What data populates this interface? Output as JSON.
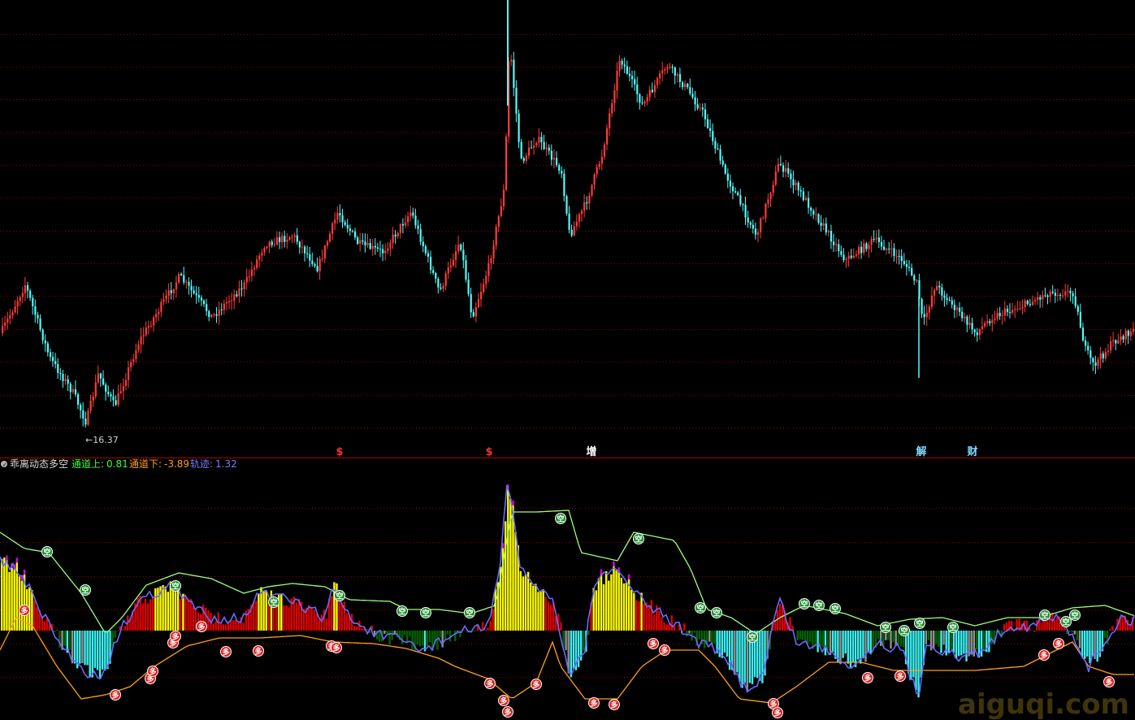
{
  "chart_data": [
    {
      "type": "candlestick",
      "low_marker_label": "16.37",
      "event_markers": [
        {
          "label": "$",
          "color": "#ff3030"
        },
        {
          "label": "$",
          "color": "#ff3030"
        },
        {
          "label": "增",
          "color": "#ffffff"
        },
        {
          "label": "解",
          "color": "#7fdcff"
        },
        {
          "label": "财",
          "color": "#7fdcff"
        }
      ],
      "colors": {
        "up": "#ff3b3b",
        "down": "#54fcfc",
        "grid": "#8b0000"
      }
    },
    {
      "type": "indicator",
      "name": "乖离动态多空",
      "legend": [
        {
          "label": "通道上:",
          "value": "0.81",
          "color": "#3cff3c"
        },
        {
          "label": "通道下:",
          "value": "-3.89",
          "color": "#ff9f1a"
        },
        {
          "label": "轨迹:",
          "value": "1.32",
          "color": "#6a6aff"
        }
      ],
      "signal_up_label": "空",
      "signal_down_label": "多",
      "colors": {
        "bar_pos": "#e00000",
        "bar_pos_high": "#ffff00",
        "bar_peak": "#e000e0",
        "bar_neg": "#006400",
        "bar_neg_low": "#3cf0f0",
        "bar_neutral": "#909090",
        "upper": "#9cff7a",
        "lower": "#ff9f1a",
        "track": "#6a6aff"
      }
    }
  ],
  "watermark": "aiguqi.com"
}
